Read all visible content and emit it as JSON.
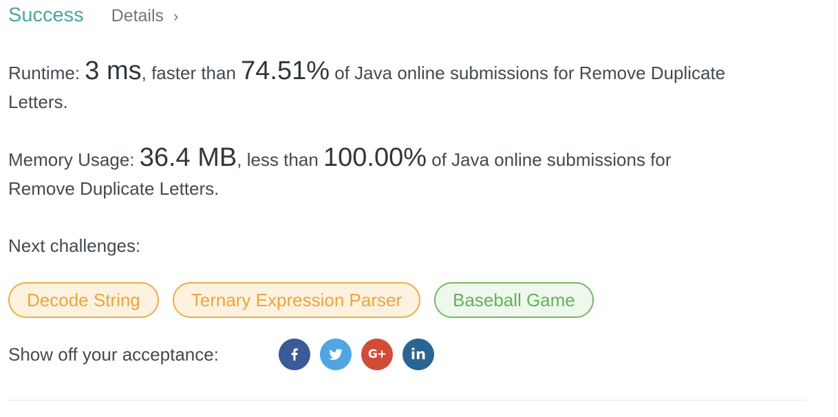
{
  "result": {
    "status": "Success",
    "details_label": "Details",
    "details_chevron": "›"
  },
  "runtime": {
    "label": "Runtime: ",
    "value": "3 ms",
    "comparison": ", faster than ",
    "percent": "74.51%",
    "tail_line1": " of Java online submissions for Remove Duplicate",
    "tail_line2": "Letters."
  },
  "memory": {
    "label": "Memory Usage: ",
    "value": "36.4 MB",
    "comparison": ", less than ",
    "percent": "100.00%",
    "tail_line1": " of Java online submissions for",
    "tail_line2": "Remove Duplicate Letters."
  },
  "next_challenges": {
    "label": "Next challenges:",
    "items": [
      {
        "label": "Decode String",
        "difficulty": "medium"
      },
      {
        "label": "Ternary Expression Parser",
        "difficulty": "medium"
      },
      {
        "label": "Baseball Game",
        "difficulty": "easy"
      }
    ]
  },
  "share": {
    "label": "Show off your acceptance:",
    "icons": [
      "facebook-icon",
      "twitter-icon",
      "google-plus-icon",
      "linkedin-icon"
    ],
    "gplus_text": "G+",
    "linkedin_text": "in"
  },
  "colors": {
    "success": "#4ba59b",
    "medium": "#eca43c",
    "easy": "#65b05a",
    "facebook": "#3b5a98",
    "twitter": "#4fa6e5",
    "google_plus": "#d14b39",
    "linkedin": "#2a6493"
  }
}
